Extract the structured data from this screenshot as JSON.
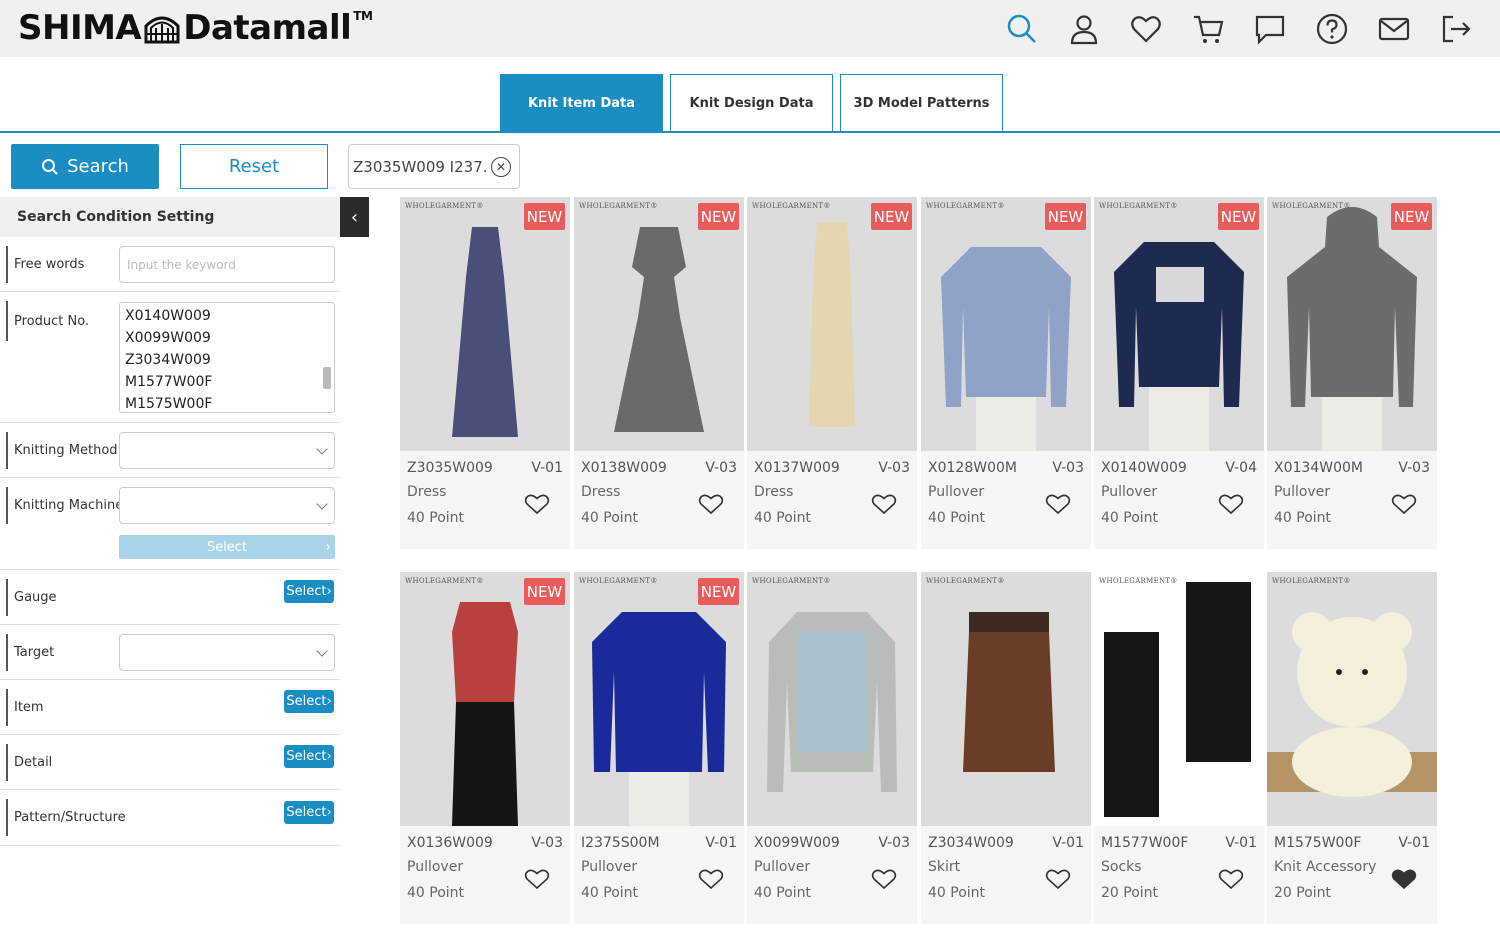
{
  "header": {
    "logo_left": "SHIMA",
    "logo_right": "Datamall",
    "logo_tm": "TM",
    "icons": [
      "search-icon",
      "user-icon",
      "heart-icon",
      "cart-icon",
      "chat-icon",
      "help-icon",
      "mail-icon",
      "logout-icon"
    ]
  },
  "tabs": [
    {
      "label": "Knit Item Data",
      "active": true
    },
    {
      "label": "Knit Design Data",
      "active": false
    },
    {
      "label": "3D Model Patterns",
      "active": false
    }
  ],
  "controls": {
    "search_label": "Search",
    "reset_label": "Reset",
    "filter_chip": "Z3035W009 I237..."
  },
  "sidebar": {
    "title": "Search Condition Setting",
    "free_words_label": "Free words",
    "free_words_placeholder": "Input the keyword",
    "product_no_label": "Product No.",
    "product_no_values": [
      "X0140W009",
      "X0099W009",
      "Z3034W009",
      "M1577W00F",
      "M1575W00F"
    ],
    "knitting_method_label": "Knitting Method",
    "knitting_machine_label": "Knitting Machine",
    "machine_select_label": "Select",
    "gauge_label": "Gauge",
    "target_label": "Target",
    "item_label": "Item",
    "detail_label": "Detail",
    "pattern_label": "Pattern/Structure",
    "select_label": "Select"
  },
  "badge_text": {
    "new": "NEW",
    "brand": "WHOLEGARMENT®"
  },
  "products": [
    {
      "no": "Z3035W009",
      "ver": "V-01",
      "cat": "Dress",
      "pts": "40 Point",
      "new": true,
      "fav": false
    },
    {
      "no": "X0138W009",
      "ver": "V-03",
      "cat": "Dress",
      "pts": "40 Point",
      "new": true,
      "fav": false
    },
    {
      "no": "X0137W009",
      "ver": "V-03",
      "cat": "Dress",
      "pts": "40 Point",
      "new": true,
      "fav": false
    },
    {
      "no": "X0128W00M",
      "ver": "V-03",
      "cat": "Pullover",
      "pts": "40 Point",
      "new": true,
      "fav": false
    },
    {
      "no": "X0140W009",
      "ver": "V-04",
      "cat": "Pullover",
      "pts": "40 Point",
      "new": true,
      "fav": false
    },
    {
      "no": "X0134W00M",
      "ver": "V-03",
      "cat": "Pullover",
      "pts": "40 Point",
      "new": true,
      "fav": false
    },
    {
      "no": "X0136W009",
      "ver": "V-03",
      "cat": "Pullover",
      "pts": "40 Point",
      "new": true,
      "fav": false
    },
    {
      "no": "I2375S00M",
      "ver": "V-01",
      "cat": "Pullover",
      "pts": "40 Point",
      "new": true,
      "fav": false
    },
    {
      "no": "X0099W009",
      "ver": "V-03",
      "cat": "Pullover",
      "pts": "40 Point",
      "new": false,
      "fav": false
    },
    {
      "no": "Z3034W009",
      "ver": "V-01",
      "cat": "Skirt",
      "pts": "40 Point",
      "new": false,
      "fav": false
    },
    {
      "no": "M1577W00F",
      "ver": "V-01",
      "cat": "Socks",
      "pts": "20 Point",
      "new": false,
      "fav": false
    },
    {
      "no": "M1575W00F",
      "ver": "V-01",
      "cat": "Knit Accessory",
      "pts": "20 Point",
      "new": false,
      "fav": true
    }
  ],
  "colors": {
    "accent": "#1a8ec2",
    "new_badge": "#e85c5c",
    "select_disabled": "#a8d4ea"
  }
}
